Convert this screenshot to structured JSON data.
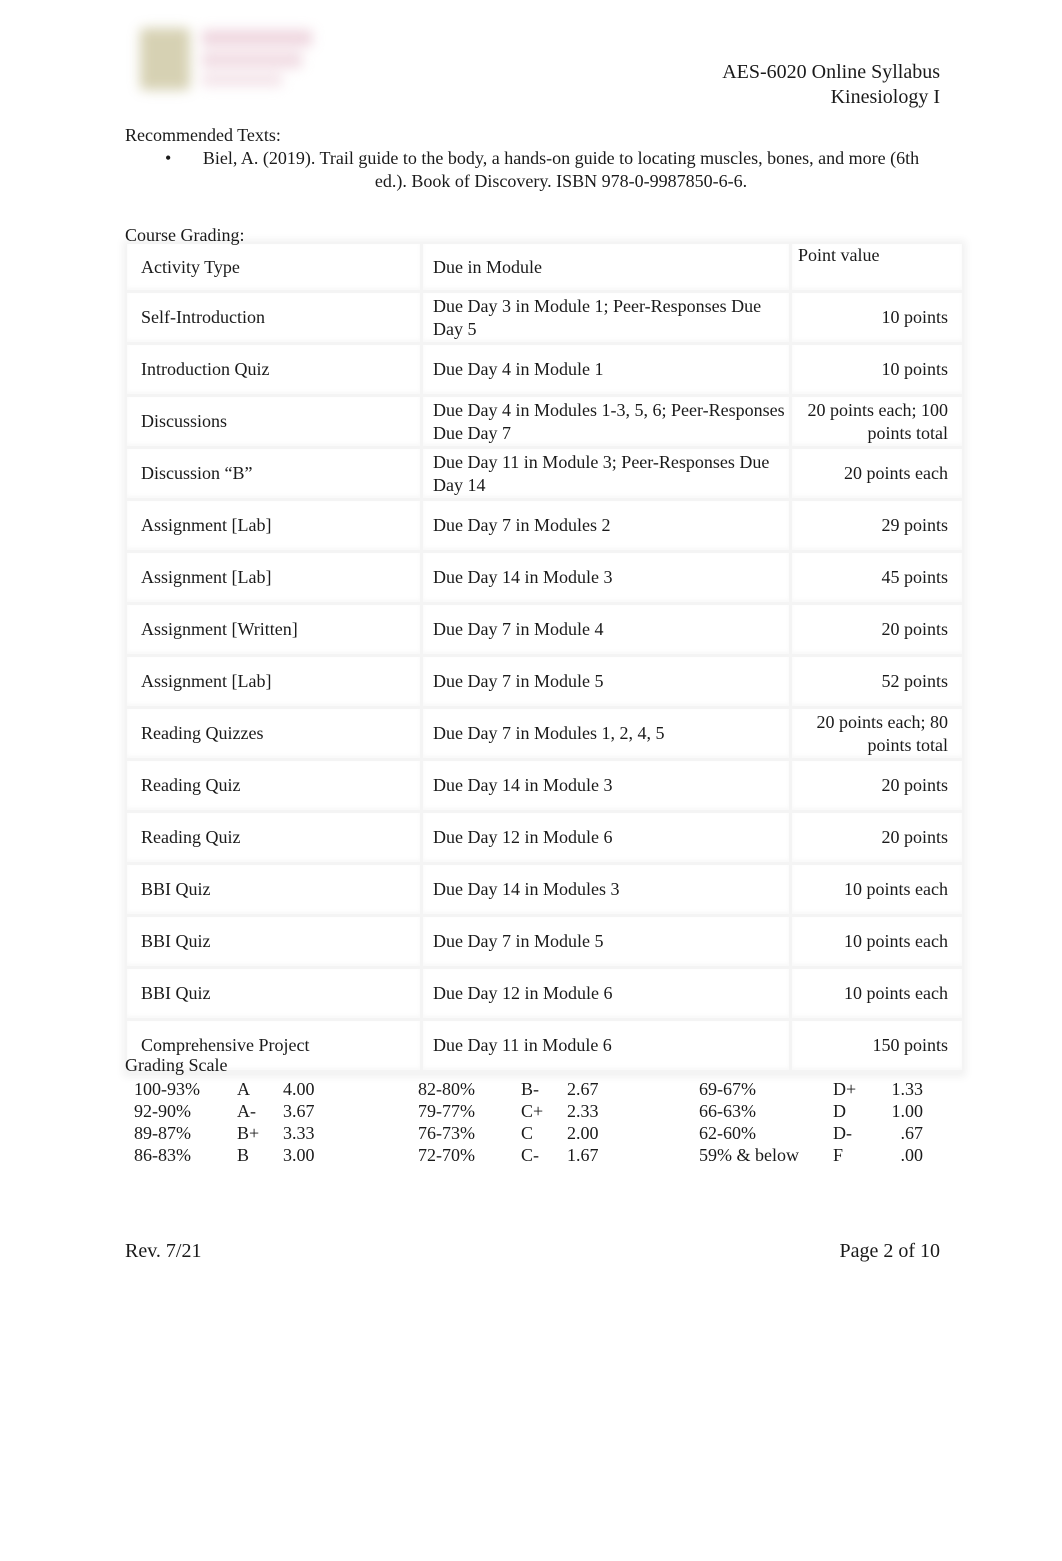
{
  "header": {
    "course_title": "AES-6020 Online Syllabus",
    "course_subtitle": "Kinesiology I"
  },
  "recommended_texts": {
    "label": "Recommended Texts:",
    "items": [
      {
        "bullet": "•",
        "text": "Biel, A. (2019). Trail guide to the body, a hands-on guide to locating muscles, bones, and more (6th ed.). Book of Discovery. ISBN 978-0-9987850-6-6."
      }
    ]
  },
  "course_grading": {
    "label": "Course Grading:",
    "columns": [
      "Activity Type",
      "Due in Module",
      "Point value"
    ],
    "rows": [
      {
        "activity": "Self-Introduction",
        "due": "Due Day 3 in Module 1; Peer-Responses Due Day 5",
        "points": "10 points"
      },
      {
        "activity": "Introduction Quiz",
        "due": "Due Day 4 in Module 1",
        "points": "10 points"
      },
      {
        "activity": "Discussions",
        "due": "Due Day 4 in Modules 1-3, 5, 6; Peer-Responses Due Day 7",
        "points": "20 points each; 100 points total"
      },
      {
        "activity": "Discussion “B”",
        "due": "Due Day 11 in Module 3; Peer-Responses Due Day 14",
        "points": "20 points each"
      },
      {
        "activity": "Assignment [Lab]",
        "due": "Due Day 7 in Modules 2",
        "points": "29 points"
      },
      {
        "activity": "Assignment [Lab]",
        "due": "Due Day 14 in Module 3",
        "points": "45 points"
      },
      {
        "activity": "Assignment [Written]",
        "due": "Due Day 7 in Module 4",
        "points": "20 points"
      },
      {
        "activity": "Assignment [Lab]",
        "due": "Due Day 7 in Module 5",
        "points": "52 points"
      },
      {
        "activity": "Reading Quizzes",
        "due": "Due Day 7 in Modules 1, 2, 4, 5",
        "points": "20 points each; 80 points total"
      },
      {
        "activity": "Reading Quiz",
        "due": "Due Day 14 in Module 3",
        "points": "20 points"
      },
      {
        "activity": "Reading Quiz",
        "due": "Due Day 12 in Module 6",
        "points": "20 points"
      },
      {
        "activity": "BBI Quiz",
        "due": "Due Day 14 in Modules 3",
        "points": "10 points each"
      },
      {
        "activity": "BBI Quiz",
        "due": "Due Day 7 in Module 5",
        "points": "10 points each"
      },
      {
        "activity": "BBI Quiz",
        "due": "Due Day 12 in Module 6",
        "points": "10 points each"
      },
      {
        "activity": "Comprehensive Project",
        "due": "Due Day 11 in Module 6",
        "points": "150 points"
      }
    ]
  },
  "grading_scale": {
    "label": "Grading Scale",
    "groups": [
      [
        {
          "range": "100-93%",
          "letter": "A",
          "gpa": "4.00"
        },
        {
          "range": "92-90%",
          "letter": "A-",
          "gpa": "3.67"
        },
        {
          "range": "89-87%",
          "letter": "B+",
          "gpa": "3.33"
        },
        {
          "range": "86-83%",
          "letter": "B",
          "gpa": "3.00"
        }
      ],
      [
        {
          "range": "82-80%",
          "letter": "B-",
          "gpa": "2.67"
        },
        {
          "range": "79-77%",
          "letter": "C+",
          "gpa": "2.33"
        },
        {
          "range": "76-73%",
          "letter": "C",
          "gpa": "2.00"
        },
        {
          "range": "72-70%",
          "letter": "C-",
          "gpa": "1.67"
        }
      ],
      [
        {
          "range": "69-67%",
          "letter": "D+",
          "gpa": "1.33"
        },
        {
          "range": "66-63%",
          "letter": "D",
          "gpa": "1.00"
        },
        {
          "range": "62-60%",
          "letter": "D-",
          "gpa": ".67"
        },
        {
          "range": "59% & below",
          "letter": "F",
          "gpa": ".00"
        }
      ]
    ]
  },
  "footer": {
    "revision": "Rev. 7/21",
    "page": "Page 2 of 10"
  }
}
